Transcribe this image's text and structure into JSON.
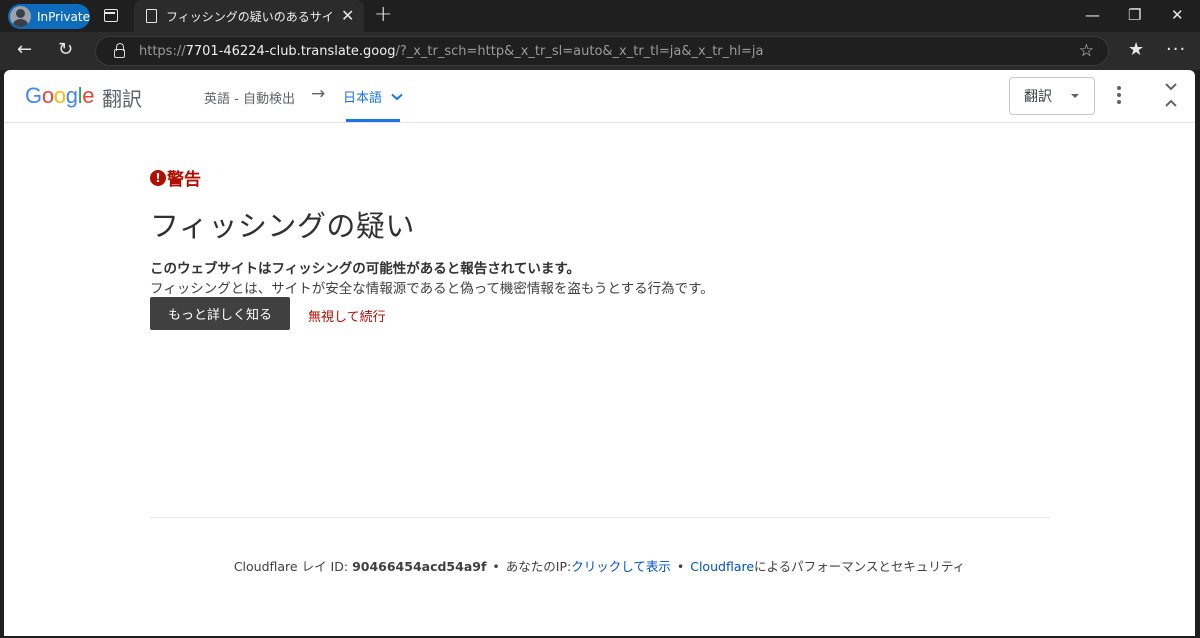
{
  "browser": {
    "inprivate_label": "InPrivate",
    "tab_title": "フィッシングの疑いのあるサイト | Cloudflare",
    "tab_close": "✕",
    "new_tab": "+",
    "win_min": "—",
    "win_restore": "❐",
    "win_close": "✕",
    "url_scheme": "https://",
    "url_host": "7701-46224-club.translate.goog",
    "url_rest": "/?_x_tr_sch=http&_x_tr_sl=auto&_x_tr_tl=ja&_x_tr_hl=ja"
  },
  "translate_bar": {
    "logo_letters": [
      "G",
      "o",
      "o",
      "g",
      "l",
      "e"
    ],
    "logo_colors": [
      "#4285f4",
      "#ea4335",
      "#fbbc05",
      "#4285f4",
      "#34a853",
      "#ea4335"
    ],
    "logo_suffix": "翻訳",
    "source_lang": "英語 - 自動検出",
    "arrow": "→",
    "target_lang": "日本語",
    "mode_select": "翻訳"
  },
  "warning": {
    "label": "警告",
    "icon": "!",
    "headline": "フィッシングの疑い",
    "lead": "このウェブサイトはフィッシングの可能性があると報告されています。",
    "description": "フィッシングとは、サイトが安全な情報源であると偽って機密情報を盗もうとする行為です。",
    "learn_more": "もっと詳しく知る",
    "ignore": "無視して続行"
  },
  "footer": {
    "ray_label": "Cloudflare レイ ID: ",
    "ray_id": "90466454acd54a9f",
    "bullet": "•",
    "ip_label": "あなたのIP:",
    "ip_link": "クリックして表示",
    "cf_link": "Cloudflare",
    "cf_suffix": "によるパフォーマンスとセキュリティ"
  }
}
